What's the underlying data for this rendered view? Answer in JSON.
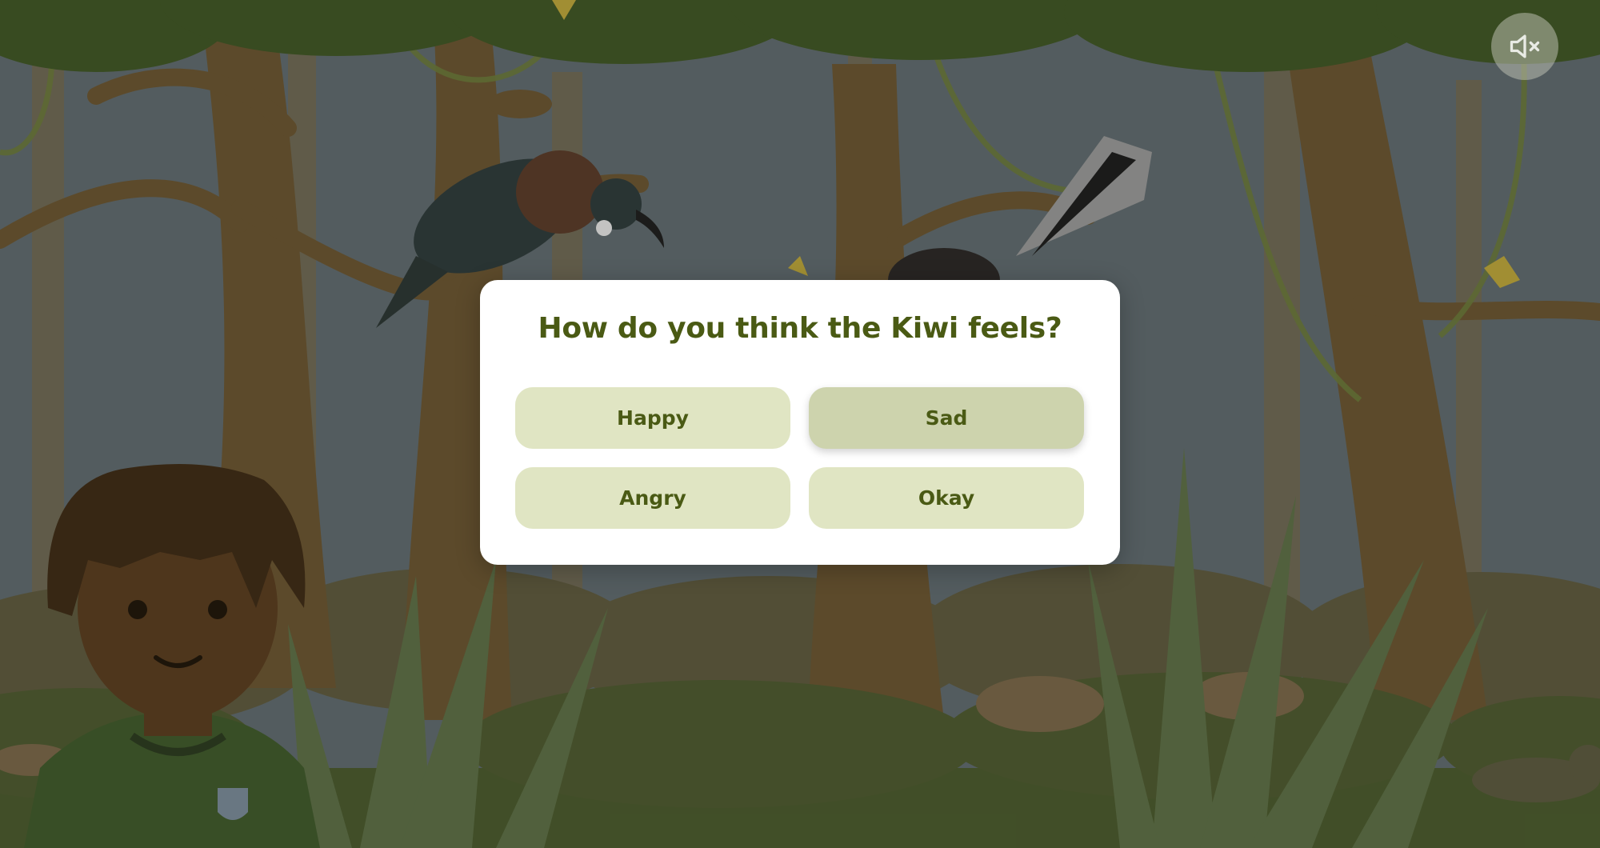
{
  "question": "How do you think the Kiwi feels?",
  "options": [
    {
      "label": "Happy",
      "selected": false
    },
    {
      "label": "Sad",
      "selected": true
    },
    {
      "label": "Angry",
      "selected": false
    },
    {
      "label": "Okay",
      "selected": false
    }
  ],
  "mute_button": {
    "icon": "speaker-muted-icon",
    "muted": true
  },
  "colors": {
    "question_text": "#4a5a14",
    "option_bg": "#e0e5c3",
    "option_selected_bg": "#cdd3ad",
    "modal_bg": "#ffffff",
    "sky": "#5f6b70",
    "foliage": "#3d5226"
  }
}
